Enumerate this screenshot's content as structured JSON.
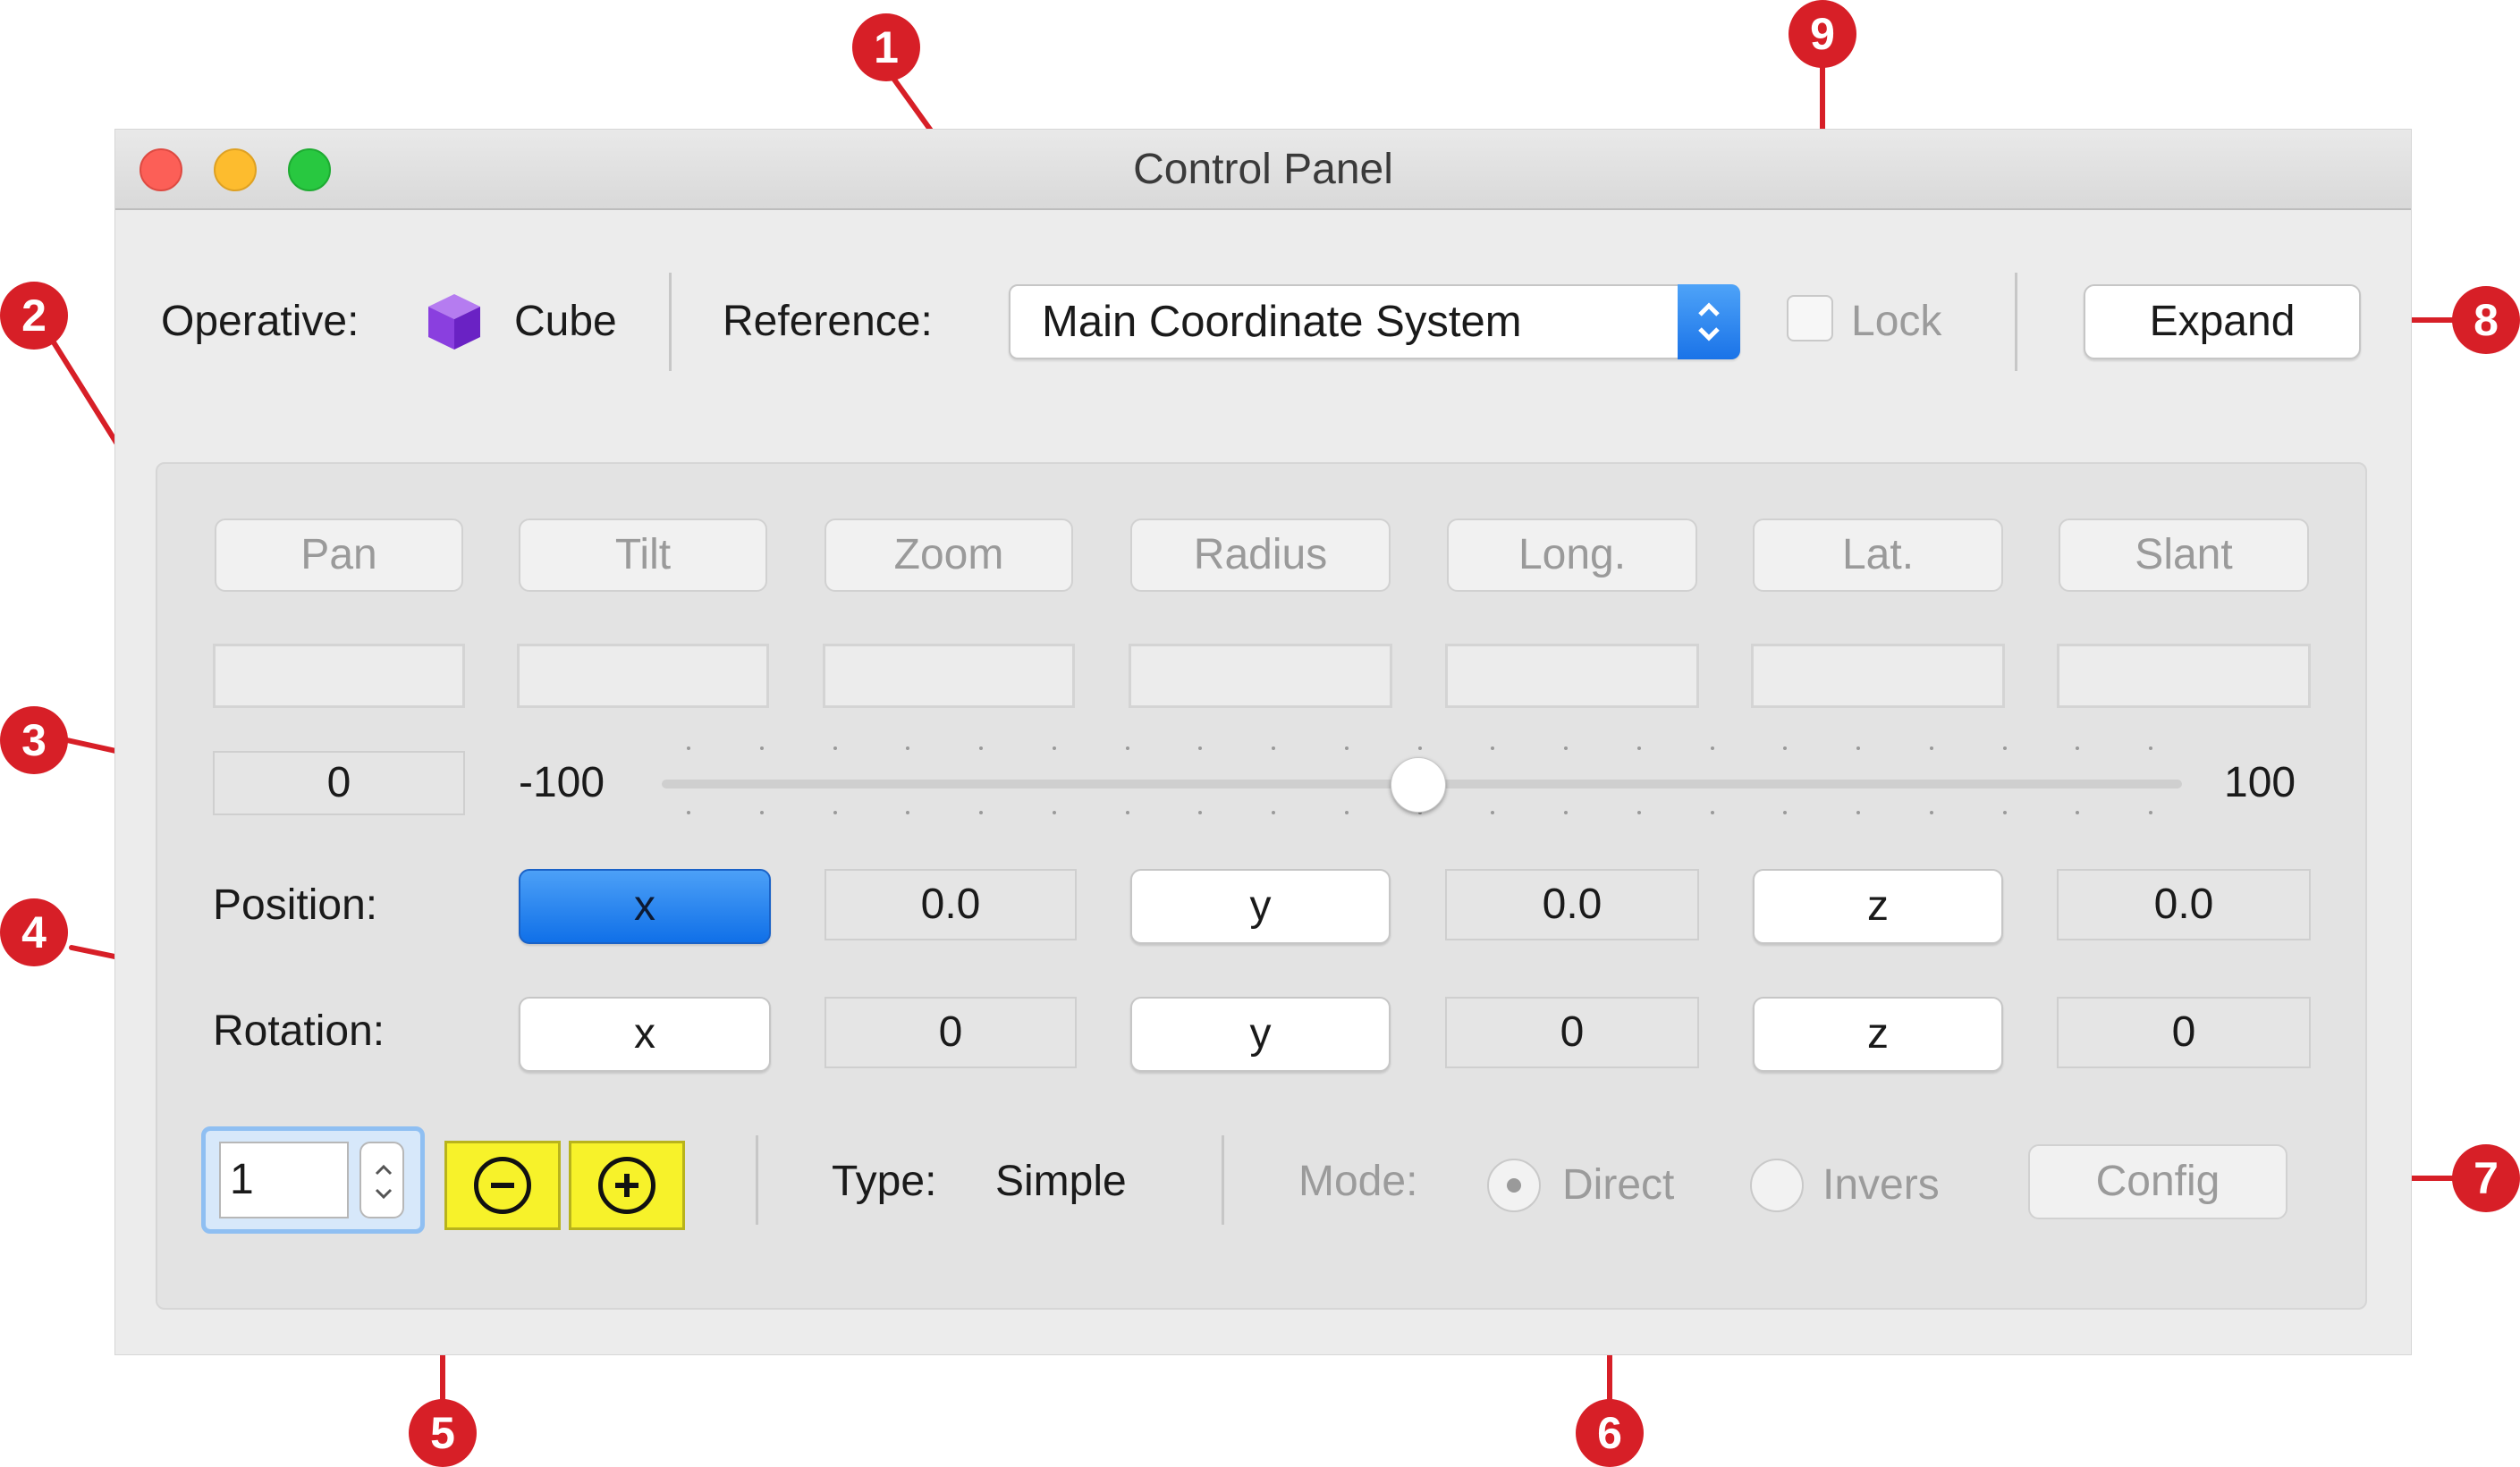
{
  "window": {
    "title": "Control Panel"
  },
  "toolbar": {
    "operative_label": "Operative:",
    "operative_value": "Cube",
    "operative_icon": "cube-icon",
    "reference_label": "Reference:",
    "reference_value": "Main Coordinate System",
    "lock_label": "Lock",
    "lock_checked": false,
    "expand_label": "Expand"
  },
  "axes": {
    "buttons": [
      "Pan",
      "Tilt",
      "Zoom",
      "Radius",
      "Long.",
      "Lat.",
      "Slant"
    ],
    "value_field": "0",
    "slider": {
      "min_label": "-100",
      "max_label": "100",
      "value": 0
    }
  },
  "position": {
    "label": "Position:",
    "x_label": "x",
    "x_value": "0.0",
    "y_label": "y",
    "y_value": "0.0",
    "z_label": "z",
    "z_value": "0.0",
    "active_axis": "x"
  },
  "rotation": {
    "label": "Rotation:",
    "x_label": "x",
    "x_value": "0",
    "y_label": "y",
    "y_value": "0",
    "z_label": "z",
    "z_value": "0"
  },
  "bottom": {
    "stepper_value": "1",
    "type_label": "Type:",
    "type_value": "Simple",
    "mode_label": "Mode:",
    "mode_direct": "Direct",
    "mode_invers": "Invers",
    "mode_selected": "Direct",
    "config_label": "Config"
  },
  "callouts": [
    "1",
    "2",
    "3",
    "4",
    "5",
    "6",
    "7",
    "8",
    "9"
  ],
  "colors": {
    "callout": "#d71f27",
    "accent": "#1a73e8",
    "highlight_buttons": "#f7f22a"
  }
}
